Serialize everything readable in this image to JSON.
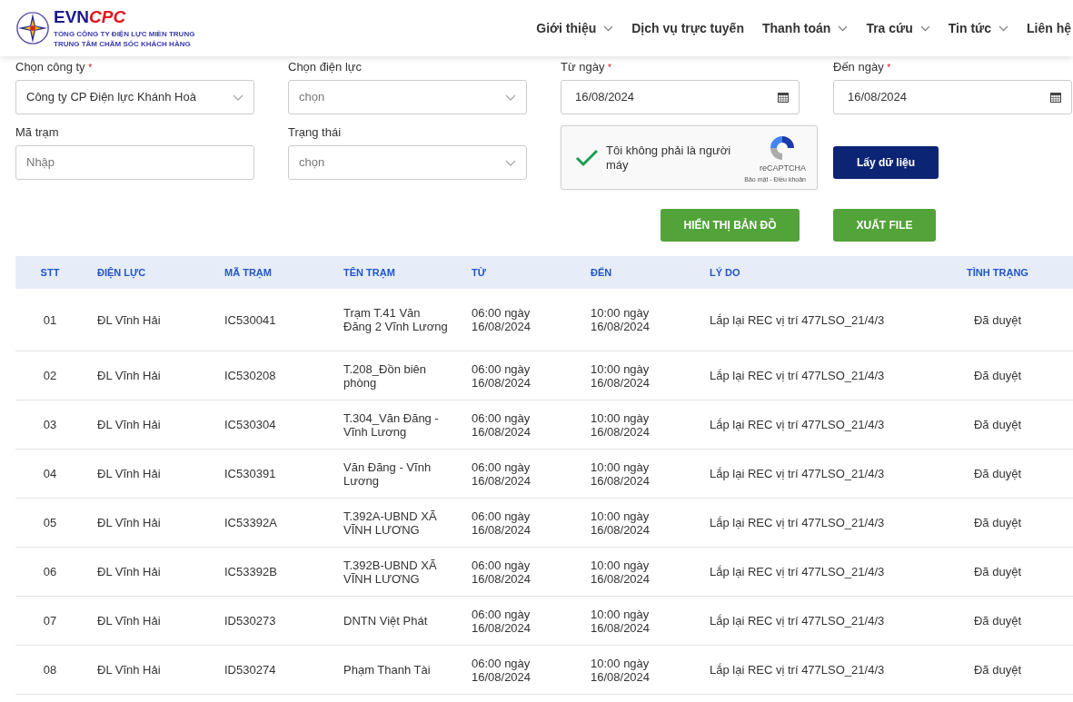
{
  "header": {
    "logo": {
      "brand_main": "EVN",
      "brand_accent": "CPC",
      "line_1": "TỔNG CÔNG TY ĐIỆN LỰC MIỀN TRUNG",
      "line_2": "TRUNG TÂM CHĂM SÓC KHÁCH HÀNG"
    },
    "nav": [
      {
        "label": "Giới thiệu",
        "has_menu": true
      },
      {
        "label": "Dịch vụ trực tuyến",
        "has_menu": false
      },
      {
        "label": "Thanh toán",
        "has_menu": true
      },
      {
        "label": "Tra cứu",
        "has_menu": true
      },
      {
        "label": "Tin tức",
        "has_menu": true
      },
      {
        "label": "Liên hệ",
        "has_menu": false
      }
    ]
  },
  "form": {
    "fields": [
      {
        "kind": "select",
        "label": "Chọn công ty",
        "required_mark": "*",
        "value": "Công ty CP Điện lực Khánh Hoà"
      },
      {
        "kind": "select",
        "label": "Chọn điện lực",
        "placeholder": "chọn"
      },
      {
        "kind": "date",
        "label": "Từ ngày",
        "required_mark": "*",
        "value": "16/08/2024"
      },
      {
        "kind": "date",
        "label": "Đến ngày",
        "required_mark": "*",
        "value": "16/08/2024"
      },
      {
        "kind": "text",
        "label": "Mã trạm",
        "placeholder": "Nhập"
      },
      {
        "kind": "select",
        "label": "Trạng thái",
        "placeholder": "chọn"
      }
    ],
    "captcha": {
      "checked": true,
      "label": "Tôi không phải là người máy",
      "brand": "reCAPTCHA",
      "links": "Bảo mật - Điều khoản"
    },
    "buttons": [
      {
        "label": "Lấy dữ liệu",
        "kind": "primary"
      },
      {
        "label": "HIỂN THỊ BẢN ĐỒ",
        "kind": "success"
      },
      {
        "label": "XUẤT FILE",
        "kind": "success"
      }
    ]
  },
  "table": {
    "columns": [
      "STT",
      "ĐIỆN LỰC",
      "MÃ TRẠM",
      "TÊN TRẠM",
      "TỪ",
      "ĐẾN",
      "LÝ DO",
      "TÌNH TRẠNG"
    ],
    "rows": [
      [
        "01",
        "ĐL Vĩnh Hải",
        "IC530041",
        "Trạm T.41 Văn Đăng 2 Vĩnh Lương",
        "06:00 ngày 16/08/2024",
        "10:00 ngày 16/08/2024",
        "Lắp lại REC vị trí 477LSO_21/4/3",
        "Đã duyệt"
      ],
      [
        "02",
        "ĐL Vĩnh Hải",
        "IC530208",
        "T.208_Đồn biên phòng",
        "06:00 ngày 16/08/2024",
        "10:00 ngày 16/08/2024",
        "Lắp lại REC vị trí 477LSO_21/4/3",
        "Đã duyệt"
      ],
      [
        "03",
        "ĐL Vĩnh Hải",
        "IC530304",
        "T.304_Văn Đăng - Vĩnh Lương",
        "06:00 ngày 16/08/2024",
        "10:00 ngày 16/08/2024",
        "Lắp lại REC vị trí 477LSO_21/4/3",
        "Đã duyệt"
      ],
      [
        "04",
        "ĐL Vĩnh Hải",
        "IC530391",
        "Văn Đăng - Vĩnh Lương",
        "06:00 ngày 16/08/2024",
        "10:00 ngày 16/08/2024",
        "Lắp lại REC vị trí 477LSO_21/4/3",
        "Đã duyệt"
      ],
      [
        "05",
        "ĐL Vĩnh Hải",
        "IC53392A",
        "T.392A-UBND XÃ VĨNH LƯƠNG",
        "06:00 ngày 16/08/2024",
        "10:00 ngày 16/08/2024",
        "Lắp lại REC vị trí 477LSO_21/4/3",
        "Đã duyệt"
      ],
      [
        "06",
        "ĐL Vĩnh Hải",
        "IC53392B",
        "T.392B-UBND XÃ VĨNH LƯƠNG",
        "06:00 ngày 16/08/2024",
        "10:00 ngày 16/08/2024",
        "Lắp lại REC vị trí 477LSO_21/4/3",
        "Đã duyệt"
      ],
      [
        "07",
        "ĐL Vĩnh Hải",
        "ID530273",
        "DNTN Việt Phát",
        "06:00 ngày 16/08/2024",
        "10:00 ngày 16/08/2024",
        "Lắp lại REC vị trí 477LSO_21/4/3",
        "Đã duyệt"
      ],
      [
        "08",
        "ĐL Vĩnh Hải",
        "ID530274",
        "Phạm Thanh Tài",
        "06:00 ngày 16/08/2024",
        "10:00 ngày 16/08/2024",
        "Lắp lại REC vị trí 477LSO_21/4/3",
        "Đã duyệt"
      ]
    ]
  }
}
